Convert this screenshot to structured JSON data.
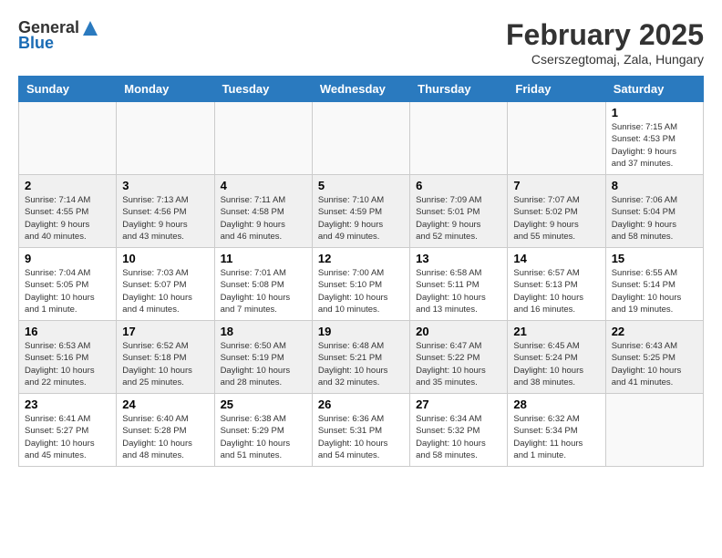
{
  "logo": {
    "general": "General",
    "blue": "Blue"
  },
  "title": "February 2025",
  "location": "Cserszegtomaj, Zala, Hungary",
  "weekdays": [
    "Sunday",
    "Monday",
    "Tuesday",
    "Wednesday",
    "Thursday",
    "Friday",
    "Saturday"
  ],
  "weeks": [
    [
      {
        "day": "",
        "info": ""
      },
      {
        "day": "",
        "info": ""
      },
      {
        "day": "",
        "info": ""
      },
      {
        "day": "",
        "info": ""
      },
      {
        "day": "",
        "info": ""
      },
      {
        "day": "",
        "info": ""
      },
      {
        "day": "1",
        "info": "Sunrise: 7:15 AM\nSunset: 4:53 PM\nDaylight: 9 hours\nand 37 minutes."
      }
    ],
    [
      {
        "day": "2",
        "info": "Sunrise: 7:14 AM\nSunset: 4:55 PM\nDaylight: 9 hours\nand 40 minutes."
      },
      {
        "day": "3",
        "info": "Sunrise: 7:13 AM\nSunset: 4:56 PM\nDaylight: 9 hours\nand 43 minutes."
      },
      {
        "day": "4",
        "info": "Sunrise: 7:11 AM\nSunset: 4:58 PM\nDaylight: 9 hours\nand 46 minutes."
      },
      {
        "day": "5",
        "info": "Sunrise: 7:10 AM\nSunset: 4:59 PM\nDaylight: 9 hours\nand 49 minutes."
      },
      {
        "day": "6",
        "info": "Sunrise: 7:09 AM\nSunset: 5:01 PM\nDaylight: 9 hours\nand 52 minutes."
      },
      {
        "day": "7",
        "info": "Sunrise: 7:07 AM\nSunset: 5:02 PM\nDaylight: 9 hours\nand 55 minutes."
      },
      {
        "day": "8",
        "info": "Sunrise: 7:06 AM\nSunset: 5:04 PM\nDaylight: 9 hours\nand 58 minutes."
      }
    ],
    [
      {
        "day": "9",
        "info": "Sunrise: 7:04 AM\nSunset: 5:05 PM\nDaylight: 10 hours\nand 1 minute."
      },
      {
        "day": "10",
        "info": "Sunrise: 7:03 AM\nSunset: 5:07 PM\nDaylight: 10 hours\nand 4 minutes."
      },
      {
        "day": "11",
        "info": "Sunrise: 7:01 AM\nSunset: 5:08 PM\nDaylight: 10 hours\nand 7 minutes."
      },
      {
        "day": "12",
        "info": "Sunrise: 7:00 AM\nSunset: 5:10 PM\nDaylight: 10 hours\nand 10 minutes."
      },
      {
        "day": "13",
        "info": "Sunrise: 6:58 AM\nSunset: 5:11 PM\nDaylight: 10 hours\nand 13 minutes."
      },
      {
        "day": "14",
        "info": "Sunrise: 6:57 AM\nSunset: 5:13 PM\nDaylight: 10 hours\nand 16 minutes."
      },
      {
        "day": "15",
        "info": "Sunrise: 6:55 AM\nSunset: 5:14 PM\nDaylight: 10 hours\nand 19 minutes."
      }
    ],
    [
      {
        "day": "16",
        "info": "Sunrise: 6:53 AM\nSunset: 5:16 PM\nDaylight: 10 hours\nand 22 minutes."
      },
      {
        "day": "17",
        "info": "Sunrise: 6:52 AM\nSunset: 5:18 PM\nDaylight: 10 hours\nand 25 minutes."
      },
      {
        "day": "18",
        "info": "Sunrise: 6:50 AM\nSunset: 5:19 PM\nDaylight: 10 hours\nand 28 minutes."
      },
      {
        "day": "19",
        "info": "Sunrise: 6:48 AM\nSunset: 5:21 PM\nDaylight: 10 hours\nand 32 minutes."
      },
      {
        "day": "20",
        "info": "Sunrise: 6:47 AM\nSunset: 5:22 PM\nDaylight: 10 hours\nand 35 minutes."
      },
      {
        "day": "21",
        "info": "Sunrise: 6:45 AM\nSunset: 5:24 PM\nDaylight: 10 hours\nand 38 minutes."
      },
      {
        "day": "22",
        "info": "Sunrise: 6:43 AM\nSunset: 5:25 PM\nDaylight: 10 hours\nand 41 minutes."
      }
    ],
    [
      {
        "day": "23",
        "info": "Sunrise: 6:41 AM\nSunset: 5:27 PM\nDaylight: 10 hours\nand 45 minutes."
      },
      {
        "day": "24",
        "info": "Sunrise: 6:40 AM\nSunset: 5:28 PM\nDaylight: 10 hours\nand 48 minutes."
      },
      {
        "day": "25",
        "info": "Sunrise: 6:38 AM\nSunset: 5:29 PM\nDaylight: 10 hours\nand 51 minutes."
      },
      {
        "day": "26",
        "info": "Sunrise: 6:36 AM\nSunset: 5:31 PM\nDaylight: 10 hours\nand 54 minutes."
      },
      {
        "day": "27",
        "info": "Sunrise: 6:34 AM\nSunset: 5:32 PM\nDaylight: 10 hours\nand 58 minutes."
      },
      {
        "day": "28",
        "info": "Sunrise: 6:32 AM\nSunset: 5:34 PM\nDaylight: 11 hours\nand 1 minute."
      },
      {
        "day": "",
        "info": ""
      }
    ]
  ]
}
